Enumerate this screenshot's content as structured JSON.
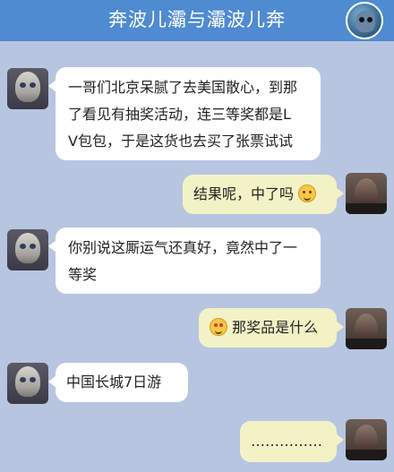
{
  "header": {
    "title": "奔波儿灞与灞波儿奔"
  },
  "messages": [
    {
      "side": "left",
      "avatar": "gollum-avatar",
      "lines": [
        "一哥们北京呆腻了去美国散心，到那",
        "了看见有抽奖活动，连三等奖都是L",
        "V包包，于是这货也去买了张票试试"
      ]
    },
    {
      "side": "right",
      "avatar": "dark-avatar",
      "text": "结果呢，中了吗",
      "emoji": "smirk-emoji"
    },
    {
      "side": "left",
      "avatar": "gollum-avatar",
      "lines": [
        "你别说这厮运气还真好，竟然中了一",
        "等奖"
      ]
    },
    {
      "side": "right",
      "avatar": "dark-avatar",
      "text": "那奖品是什么",
      "emoji": "heart-eyes-emoji"
    },
    {
      "side": "left",
      "avatar": "gollum-avatar",
      "text": "中国长城7日游"
    },
    {
      "side": "right",
      "avatar": "dark-avatar",
      "text": "……………"
    }
  ]
}
